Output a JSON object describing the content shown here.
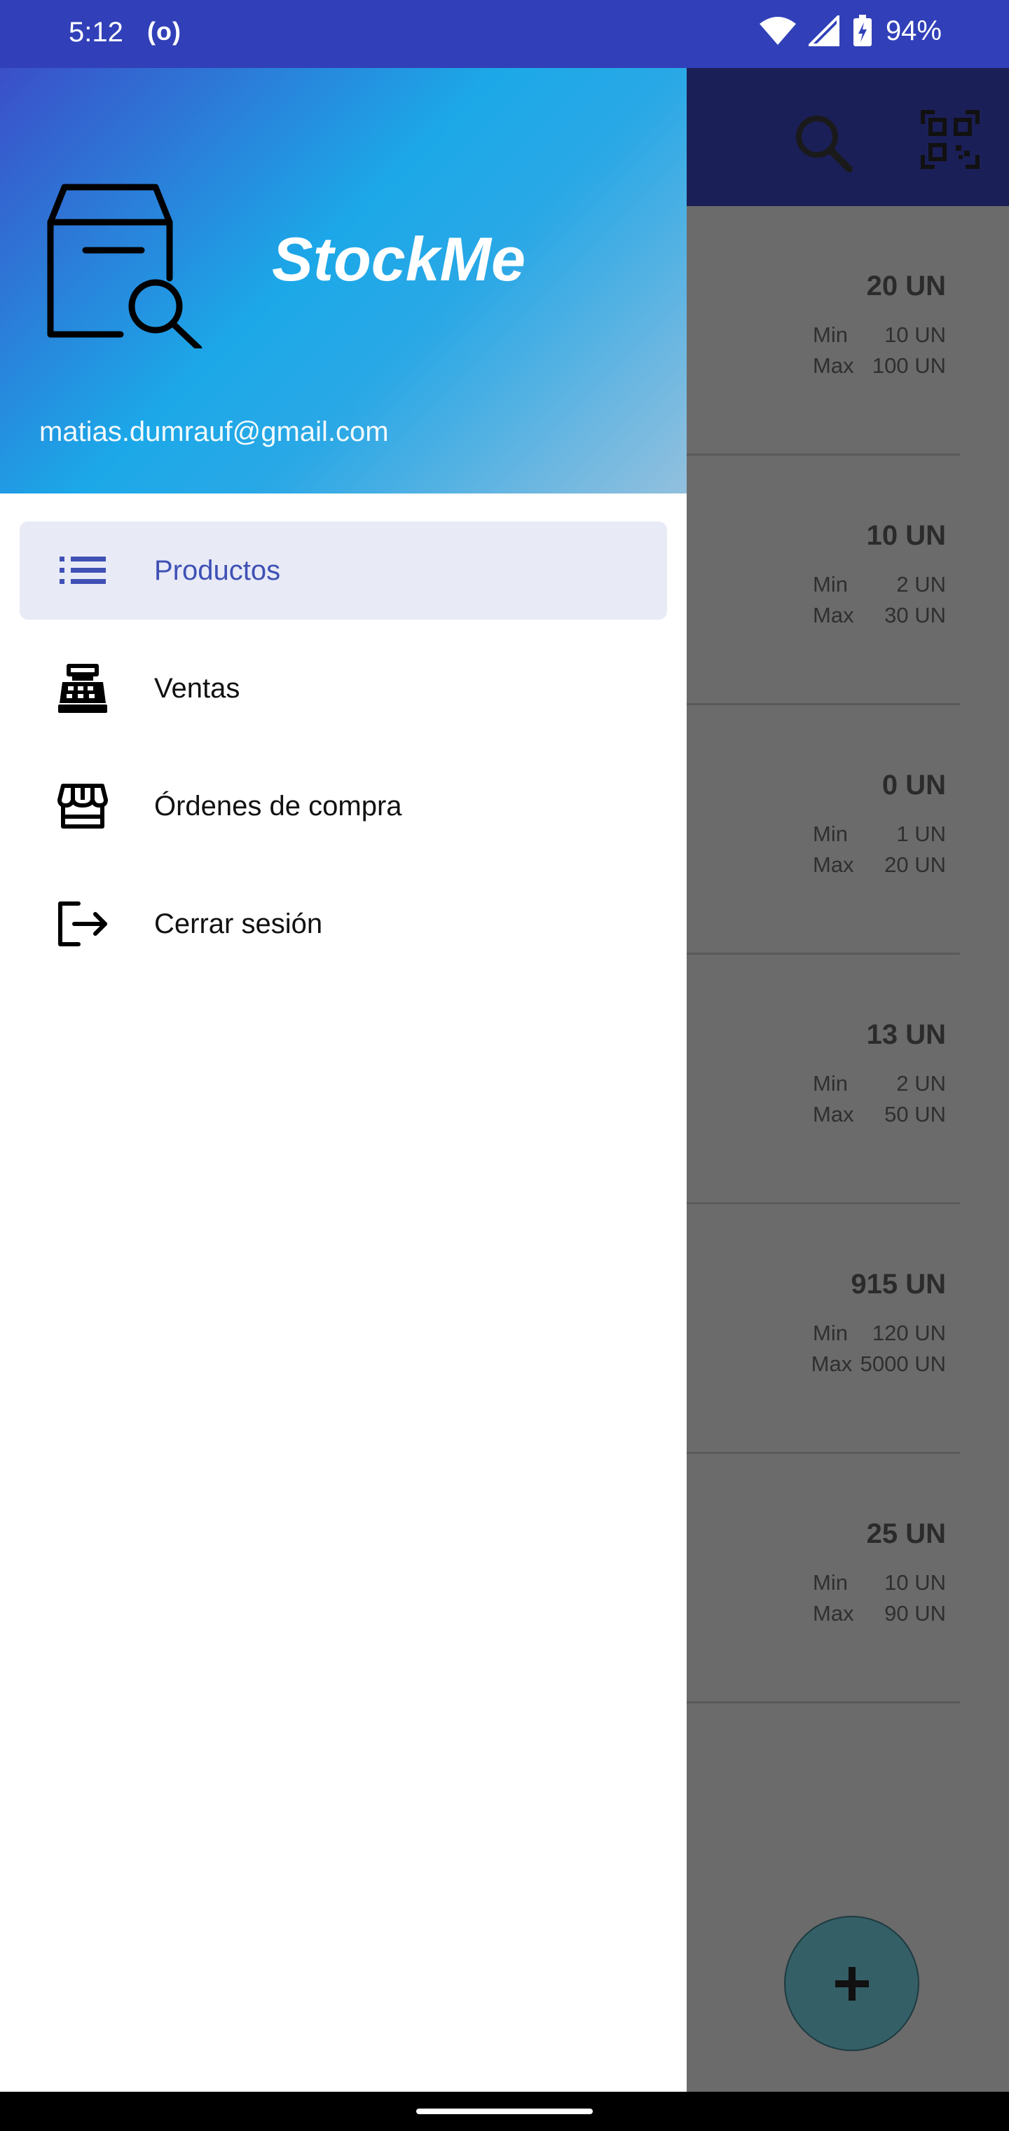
{
  "status_bar": {
    "time": "5:12",
    "hotspot": "(o)",
    "battery": "94%"
  },
  "app_bar": {
    "actions": [
      "search-icon",
      "qr-scan-icon"
    ]
  },
  "products": [
    {
      "stock": "20 UN",
      "min_label": "Min",
      "min": "10 UN",
      "max_label": "Max",
      "max": "100 UN"
    },
    {
      "stock": "10 UN",
      "min_label": "Min",
      "min": "2 UN",
      "max_label": "Max",
      "max": "30 UN"
    },
    {
      "stock": "0 UN",
      "min_label": "Min",
      "min": "1 UN",
      "max_label": "Max",
      "max": "20 UN"
    },
    {
      "stock": "13 UN",
      "min_label": "Min",
      "min": "2 UN",
      "max_label": "Max",
      "max": "50 UN"
    },
    {
      "stock": "915 UN",
      "min_label": "Min",
      "min": "120 UN",
      "max_label": "Max",
      "max": "5000 UN"
    },
    {
      "stock": "25 UN",
      "min_label": "Min",
      "min": "10 UN",
      "max_label": "Max",
      "max": "90 UN"
    }
  ],
  "fab": {
    "label": "+"
  },
  "drawer": {
    "app_name": "StockMe",
    "email": "matias.dumrauf@gmail.com",
    "items": [
      {
        "label": "Productos",
        "icon": "list-icon",
        "active": true
      },
      {
        "label": "Ventas",
        "icon": "cash-register-icon",
        "active": false
      },
      {
        "label": "Órdenes de compra",
        "icon": "store-icon",
        "active": false
      },
      {
        "label": "Cerrar sesión",
        "icon": "logout-icon",
        "active": false
      }
    ]
  },
  "colors": {
    "status_bar": "#3140b8",
    "accent": "#3f51b5",
    "active_item_bg": "#e8eaf6",
    "header_gradient": [
      "#3b4fc8",
      "#1ca8e8",
      "#93c0de"
    ]
  }
}
